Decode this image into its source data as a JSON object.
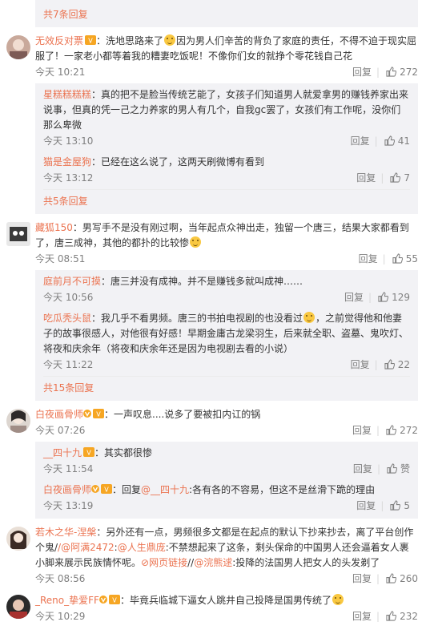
{
  "top_more": "共7条回复",
  "c1": {
    "user": "无效反对票",
    "text": "：洗地思路来了",
    "text2": "因为男人们辛苦的背负了家庭的责任，不得不迫于现实屈服了！一家老小都等着我的糟妻吃饭呢！不像你们女的就挣个零花钱自己花",
    "time": "今天 10:21",
    "reply": "回复",
    "likes": "272",
    "replies": [
      {
        "user": "星糕糕糕糕",
        "text": "：真的把不是脸当传统艺能了，女孩子们知道男人就爱拿男的赚钱养家出来说事，但真的凭一己之力养家的男人有几个，自我gc罢了，女孩们有工作呢，没你们那么卑微",
        "time": "今天 13:10",
        "reply": "回复",
        "likes": "41"
      },
      {
        "user": "猫是金屋狗",
        "text": "：已经在这么说了，这两天刷微博有看到",
        "time": "今天 13:12",
        "reply": "回复",
        "likes": "7"
      }
    ],
    "more": "共5条回复"
  },
  "c2": {
    "user": "藏狐150",
    "text": "：男写手不是没有刚过啊，当年起点众神出走，独留一个唐三，结果大家都看到了，唐三成神，其他的都扑的比较惨",
    "time": "今天 08:51",
    "reply": "回复",
    "likes": "55",
    "replies": [
      {
        "user": "庭前月不可摸",
        "text": "：唐三并没有成神。并不是赚钱多就叫成神……",
        "time": "今天 10:56",
        "reply": "回复",
        "likes": "129"
      },
      {
        "user": "吃瓜秃头鼠",
        "text": "：我几乎不看男频。唐三的书拍电视剧的也没看过",
        "text2": "，之前觉得他和他妻子的故事很感人，对他很有好感！早期金庸古龙梁羽生，后来就全职、盗墓、鬼吹灯、将夜和庆余年（将夜和庆余年还是因为电视剧去看的小说）",
        "time": "今天 11:22",
        "reply": "回复",
        "likes": "22"
      }
    ],
    "more": "共15条回复"
  },
  "c3": {
    "user": "白夜画骨师",
    "text": "：一声叹息....说多了要被扣内讧的锅",
    "time": "今天 07:26",
    "reply": "回复",
    "likes": "272",
    "replies": [
      {
        "user": "__四十九",
        "text": "：其实都很惨",
        "time": "今天 11:54",
        "reply": "回复",
        "likes": "赞"
      },
      {
        "user": "白夜画骨师",
        "text": "：回复",
        "mention": "@__四十九",
        "text2": ":各有各的不容易，但这不是丝滑下跪的理由",
        "time": "今天 13:19",
        "reply": "回复",
        "likes": "5"
      }
    ]
  },
  "c4": {
    "user": "若木之华-涅槃",
    "text": "：另外还有一点，男频很多文都是在起点的默认下抄来抄去，离了平台创作个鬼/",
    "m1": "/@阿满2472",
    "t2": ":",
    "m2": "@人生鼎庞",
    "t3": ":不禁想起来了这条，剩头保命的中国男人还会逼着女人裹小脚来展示民族情怀呢。",
    "link": "网页链接",
    "t4": "//",
    "m3": "@浣熊逑",
    "t5": ":投降的法国男人把女人的头发剃了",
    "time": "今天 08:56",
    "reply": "回复",
    "likes": "260"
  },
  "c5": {
    "user": "_Reno_挚爱FF",
    "text": "：毕竟兵临城下逼女人跳井自己投降是国男传统了",
    "time": "今天 10:29",
    "reply": "回复",
    "likes": "232"
  },
  "colors": {
    "accent": "#eb7350",
    "meta": "#808080",
    "reply_bg": "#f2f2f5"
  }
}
